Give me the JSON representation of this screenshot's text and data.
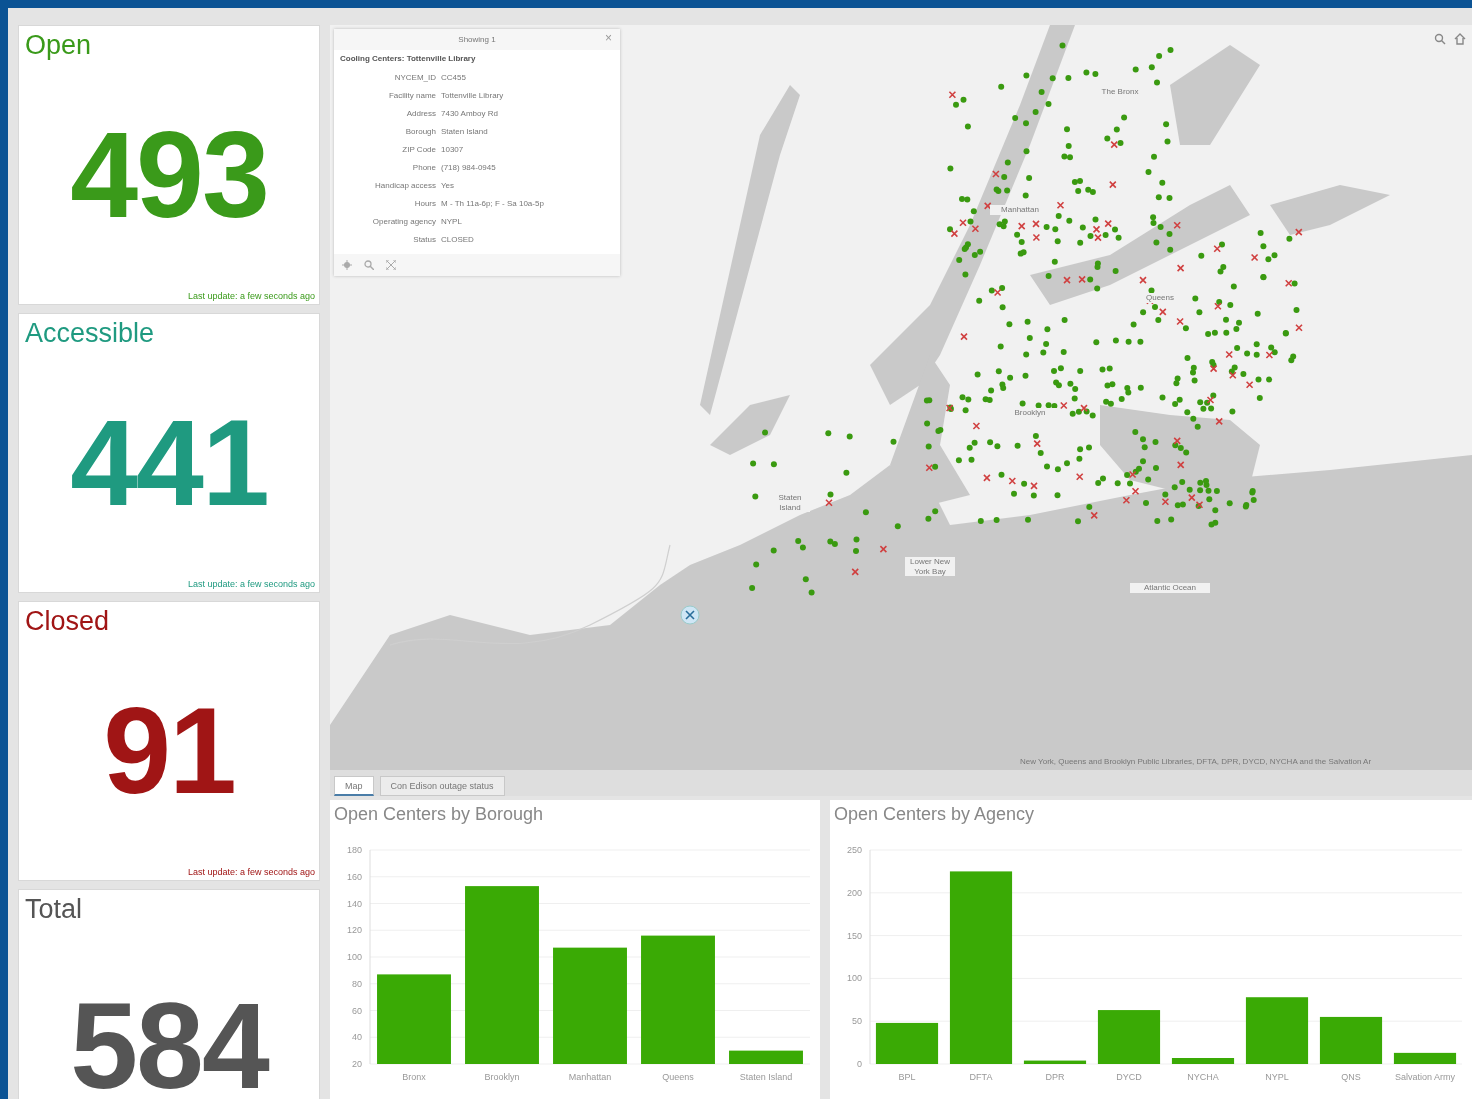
{
  "indicators": [
    {
      "title": "Open",
      "value": "493",
      "footer": "Last update: a few seconds ago",
      "color": "#3a9a1a"
    },
    {
      "title": "Accessible",
      "value": "441",
      "footer": "Last update: a few seconds ago",
      "color": "#1f9a80"
    },
    {
      "title": "Closed",
      "value": "91",
      "footer": "Last update: a few seconds ago",
      "color": "#a01515"
    },
    {
      "title": "Total",
      "value": "584",
      "color": "#555555"
    }
  ],
  "map": {
    "labels": [
      "The Bronx",
      "Manhattan",
      "Queens",
      "Brooklyn",
      "Staten Island",
      "Lower New York Bay",
      "Atlantic Ocean"
    ],
    "attribution": "New York, Queens and Brooklyn Public Libraries, DFTA, DPR, DYCD, NYCHA and the Salvation Ar",
    "popup": {
      "header": "Showing 1",
      "close": "×",
      "title": "Cooling Centers: Tottenville Library",
      "fields": [
        {
          "label": "NYCEM_ID",
          "value": "CC455"
        },
        {
          "label": "Facility name",
          "value": "Tottenville Library"
        },
        {
          "label": "Address",
          "value": "7430 Amboy Rd"
        },
        {
          "label": "Borough",
          "value": "Staten Island"
        },
        {
          "label": "ZIP Code",
          "value": "10307"
        },
        {
          "label": "Phone",
          "value": "(718) 984-0945"
        },
        {
          "label": "Handicap access",
          "value": "Yes"
        },
        {
          "label": "Hours",
          "value": "M - Th 11a-6p; F - Sa 10a-5p"
        },
        {
          "label": "Operating agency",
          "value": "NYPL"
        },
        {
          "label": "Status",
          "value": "CLOSED"
        }
      ]
    }
  },
  "tabs": [
    {
      "label": "Map",
      "selected": true
    },
    {
      "label": "Con Edison outage status",
      "selected": false
    }
  ],
  "charts": [
    {
      "chart_data": {
        "type": "bar",
        "title": "Open Centers by Borough",
        "categories": [
          "Bronx",
          "Brooklyn",
          "Manhattan",
          "Queens",
          "Staten Island"
        ],
        "series": [
          {
            "color": "#3aaa05",
            "values": [
              87,
              153,
              107,
              116,
              30
            ]
          }
        ],
        "grid": true,
        "ylim": [
          20,
          180
        ],
        "yticks": [
          20,
          40,
          60,
          80,
          100,
          120,
          140,
          160,
          180
        ]
      }
    },
    {
      "chart_data": {
        "type": "bar",
        "title": "Open Centers by Agency",
        "categories": [
          "BPL",
          "DFTA",
          "DPR",
          "DYCD",
          "NYCHA",
          "NYPL",
          "QNS",
          "Salvation Army"
        ],
        "series": [
          {
            "color": "#3aaa05",
            "values": [
              48,
              225,
              4,
              63,
              7,
              78,
              55,
              13
            ]
          }
        ],
        "grid": true,
        "ylim": [
          0,
          250
        ],
        "yticks": [
          0,
          50,
          100,
          150,
          200,
          250
        ]
      }
    }
  ]
}
